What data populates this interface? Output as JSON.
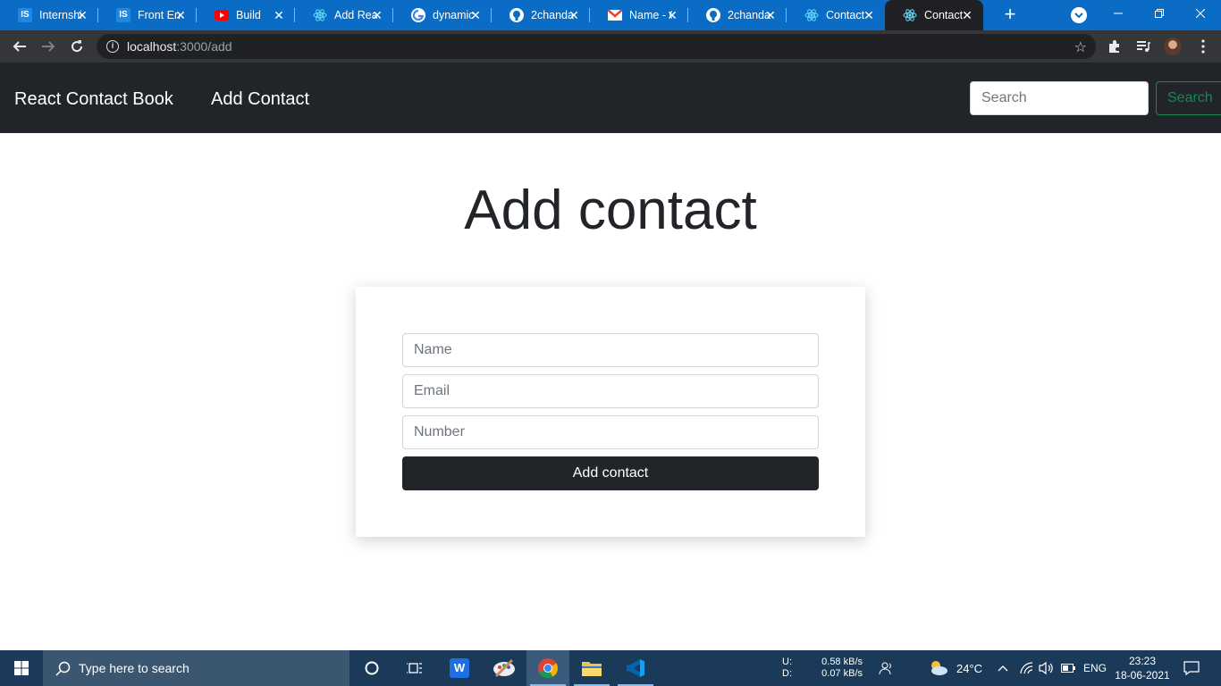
{
  "browser": {
    "tabs": [
      {
        "title": "Internship",
        "icon": "is-favicon-icon",
        "active": false
      },
      {
        "title": "Front End",
        "icon": "is-favicon-icon",
        "active": false
      },
      {
        "title": "Build",
        "icon": "youtube-favicon-icon",
        "active": false
      },
      {
        "title": "Add React",
        "icon": "react-favicon-icon",
        "active": false
      },
      {
        "title": "dynamic",
        "icon": "google-favicon-icon",
        "active": false
      },
      {
        "title": "2chanda",
        "icon": "github-favicon-icon",
        "active": false
      },
      {
        "title": "Name - G",
        "icon": "gmail-favicon-icon",
        "active": false
      },
      {
        "title": "2chanda",
        "icon": "github-favicon-icon",
        "active": false
      },
      {
        "title": "Contact",
        "icon": "react-favicon-icon",
        "active": false
      },
      {
        "title": "Contact",
        "icon": "react-favicon-icon",
        "active": true
      }
    ],
    "url_host": "localhost",
    "url_path": ":3000/add"
  },
  "navbar": {
    "brand": "React Contact Book",
    "link": "Add Contact",
    "search_placeholder": "Search",
    "search_button": "Search"
  },
  "main": {
    "heading": "Add contact",
    "form": {
      "name_placeholder": "Name",
      "email_placeholder": "Email",
      "number_placeholder": "Number",
      "submit_label": "Add contact"
    }
  },
  "taskbar": {
    "search_placeholder": "Type here to search",
    "net_up_label": "U:",
    "net_down_label": "D:",
    "net_up": "0.58 kB/s",
    "net_down": "0.07 kB/s",
    "weather": "24°C",
    "language": "ENG",
    "time": "23:23",
    "date": "18-06-2021"
  },
  "colors": {
    "tabstrip": "#0a6cc4",
    "navbar": "#212529",
    "success": "#198754",
    "taskbar": "#1b3a5a"
  }
}
